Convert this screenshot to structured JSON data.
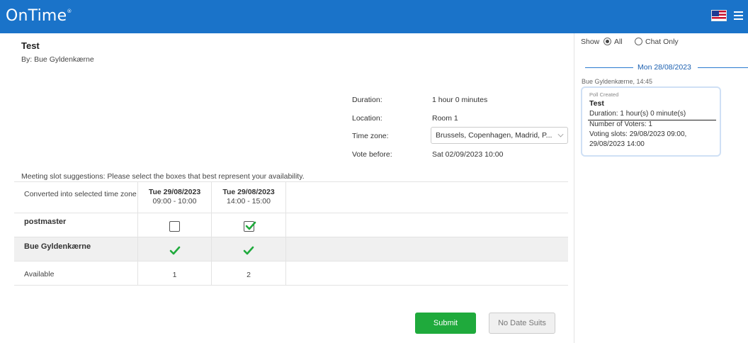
{
  "app": {
    "logo_text": "OnTime",
    "logo_mark": "®"
  },
  "header": {
    "flag_icon": "us-flag-icon",
    "menu_icon": "hamburger-menu-icon"
  },
  "meeting": {
    "title": "Test",
    "author": "By: Bue Gyldenkærne",
    "duration_label": "Duration:",
    "duration_value": "1 hour 0 minutes",
    "location_label": "Location:",
    "location_value": "Room 1",
    "timezone_label": "Time zone:",
    "timezone_value": "Brussels, Copenhagen, Madrid, P...",
    "vote_before_label": "Vote before:",
    "vote_before_value": "Sat 02/09/2023  10:00"
  },
  "poll": {
    "instruction": "Meeting slot suggestions: Please select the boxes that best represent your availability.",
    "converted_label": "Converted into selected time zone",
    "slots": [
      {
        "date": "Tue 29/08/2023",
        "time": "09:00 - 10:00"
      },
      {
        "date": "Tue 29/08/2023",
        "time": "14:00 - 15:00"
      }
    ],
    "rows": [
      {
        "name": "postmaster",
        "votes": [
          "unchecked",
          "checked"
        ]
      },
      {
        "name": "Bue Gyldenkærne",
        "votes": [
          "yes",
          "yes"
        ]
      }
    ],
    "available_label": "Available",
    "available_counts": [
      "1",
      "2"
    ],
    "colors": {
      "accent": "#1a73c9",
      "check": "#1faa3c"
    }
  },
  "actions": {
    "submit_label": "Submit",
    "no_date_label": "No Date Suits"
  },
  "chat": {
    "show_label": "Show",
    "filter_all": "All",
    "filter_chat": "Chat Only",
    "date_separator": "Mon 28/08/2023",
    "message_meta": "Bue Gyldenkærne, 14:45",
    "message": {
      "type_label": "Poll Created",
      "title": "Test",
      "duration": "Duration: 1 hour(s) 0 minute(s)",
      "voters": "Number of Voters: 1",
      "slots_line1": "Voting slots: 29/08/2023 09:00,",
      "slots_line2": " 29/08/2023 14:00"
    }
  }
}
